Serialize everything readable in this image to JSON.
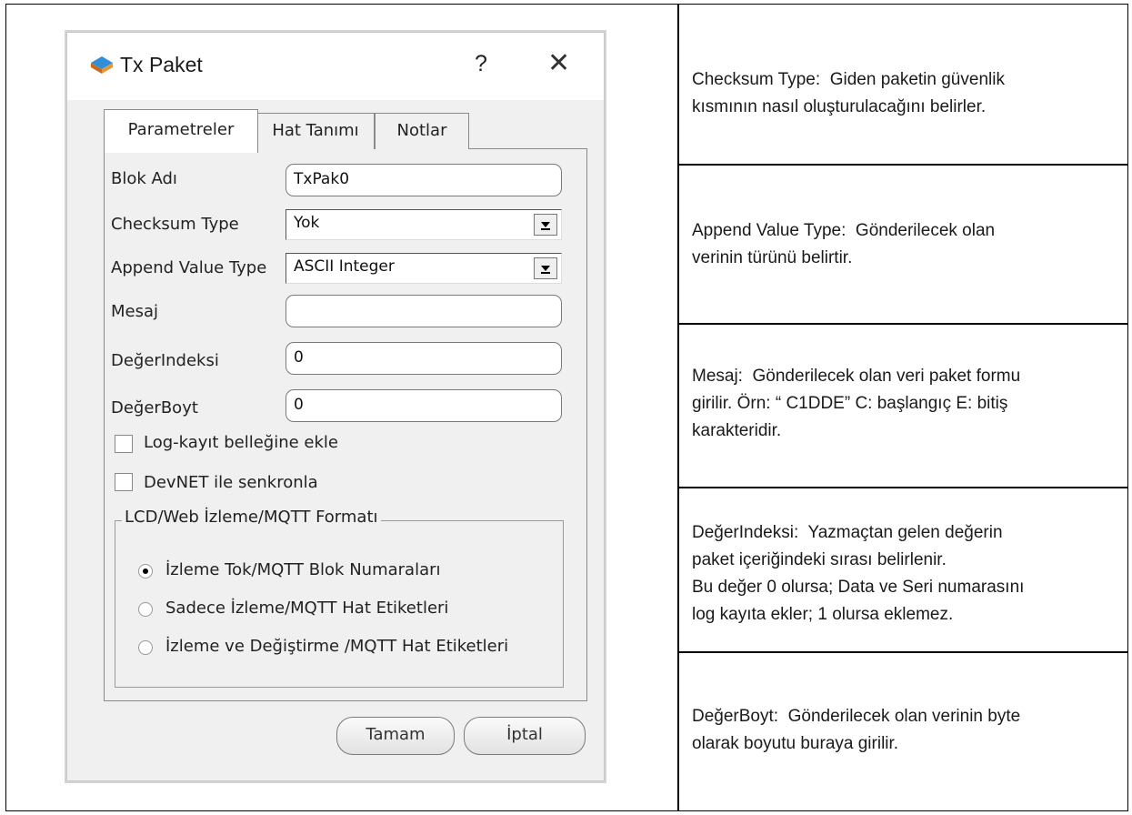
{
  "dialog": {
    "title": "Tx Paket",
    "help_label": "?",
    "close_label": "✕",
    "tabs": [
      "Parametreler",
      "Hat Tanımı",
      "Notlar"
    ],
    "fields": [
      {
        "label": "Blok Adı",
        "value": "TxPak0"
      },
      {
        "label": "Checksum Type",
        "value": "Yok"
      },
      {
        "label": "Append Value Type",
        "value": "ASCII Integer"
      },
      {
        "label": "Mesaj",
        "value": ""
      },
      {
        "label": "DeğerIndeksi",
        "value": "0"
      },
      {
        "label": "DeğerBoyt",
        "value": "0"
      }
    ],
    "checkboxes": [
      {
        "label": "Log-kayıt belleğine ekle",
        "checked": false
      },
      {
        "label": "DevNET ile senkronla",
        "checked": false
      }
    ],
    "group": {
      "title": "LCD/Web İzleme/MQTT Formatı",
      "options": [
        {
          "label": "İzleme Tok/MQTT Blok Numaraları",
          "selected": true
        },
        {
          "label": "Sadece İzleme/MQTT Hat Etiketleri",
          "selected": false
        },
        {
          "label": "İzleme ve Değiştirme /MQTT Hat Etiketleri",
          "selected": false
        }
      ]
    },
    "ok_label": "Tamam",
    "cancel_label": "İptal"
  },
  "descriptions": [
    [
      "Checksum Type:  Giden paketin güvenlik",
      "kısmının nasıl oluşturulacağını belirler."
    ],
    [
      "Append Value Type:  Gönderilecek olan",
      "verinin türünü belirtir."
    ],
    [
      "Mesaj:  Gönderilecek olan veri paket formu",
      "girilir. Örn: “ C1DDE” C: başlangıç E: bitiş",
      "karakteridir."
    ],
    [
      "DeğerIndeksi:  Yazmaçtan gelen değerin",
      "paket içeriğindeki sırası belirlenir.",
      "Bu değer 0 olursa; Data ve Seri numarasını",
      "log kayıta ekler; 1 olursa eklemez."
    ],
    [
      "DeğerBoyt:  Gönderilecek olan verinin byte",
      "olarak boyutu buraya girilir."
    ]
  ]
}
